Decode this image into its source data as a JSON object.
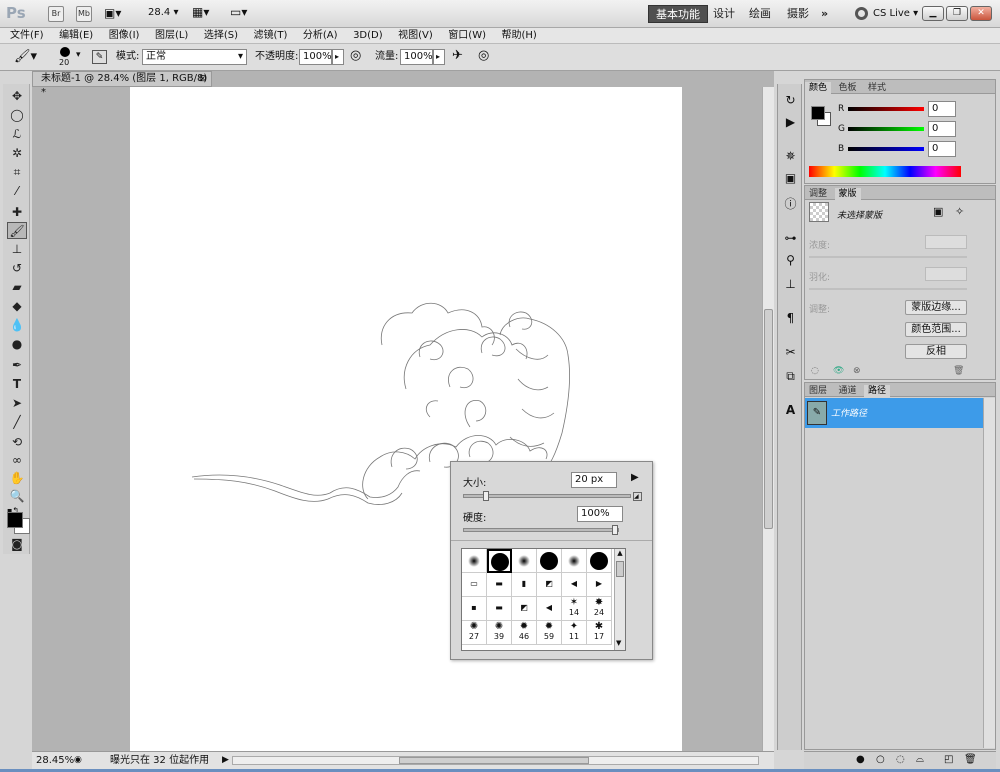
{
  "app": {
    "logo": "Ps",
    "br_btn": "Br",
    "mb_btn": "Mb",
    "zoom_value": "28.4",
    "workspaces": [
      "基本功能",
      "设计",
      "绘画",
      "摄影"
    ],
    "more": "»",
    "cs_live": "CS Live"
  },
  "menu": [
    "文件(F)",
    "编辑(E)",
    "图像(I)",
    "图层(L)",
    "选择(S)",
    "滤镜(T)",
    "分析(A)",
    "3D(D)",
    "视图(V)",
    "窗口(W)",
    "帮助(H)"
  ],
  "options": {
    "brush_size": "20",
    "mode_label": "模式:",
    "mode_value": "正常",
    "opacity_label": "不透明度:",
    "opacity_value": "100%",
    "flow_label": "流量:",
    "flow_value": "100%"
  },
  "document": {
    "tab_title": "未标题-1 @ 28.4% (图层 1, RGB/8) *",
    "zoom_status": "28.45%",
    "status_text": "曝光只在 32 位起作用"
  },
  "brush_popup": {
    "size_label": "大小:",
    "size_value": "20 px",
    "size_fraction": 0.12,
    "hardness_label": "硬度:",
    "hardness_value": "100%",
    "hardness_fraction": 1.0,
    "preset_numbers": [
      "14",
      "24",
      "27",
      "39",
      "46",
      "59",
      "11",
      "17"
    ]
  },
  "color_panel": {
    "tabs": [
      "颜色",
      "色板",
      "样式"
    ],
    "r_label": "R",
    "g_label": "G",
    "b_label": "B",
    "r_value": "0",
    "g_value": "0",
    "b_value": "0"
  },
  "masks_panel": {
    "tabs": [
      "调整",
      "蒙版"
    ],
    "no_mask": "未选择蒙版",
    "density": "浓度:",
    "feather": "羽化:",
    "refine": "调整:",
    "btn_mask_edge": "蒙版边缘...",
    "btn_color_range": "颜色范围...",
    "btn_invert": "反相"
  },
  "layers_panel": {
    "tabs": [
      "图层",
      "通道",
      "路径"
    ],
    "path_name": "工作路径"
  },
  "colors": {
    "selection": "#3d9be9",
    "canvas": "#ffffff",
    "workspace_bg": "#b3b3b3"
  }
}
